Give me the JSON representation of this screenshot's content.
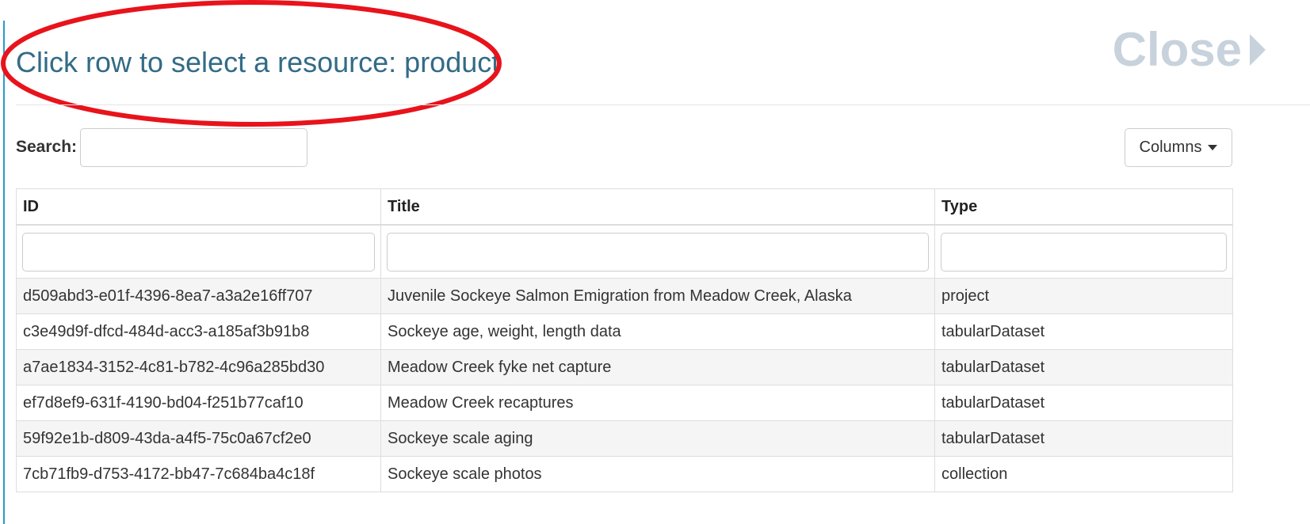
{
  "modal": {
    "title": "Click row to select a resource: product",
    "close_label": "Close"
  },
  "search": {
    "label": "Search:",
    "value": "",
    "placeholder": ""
  },
  "columns_button": {
    "label": "Columns"
  },
  "annotation": {
    "color": "#e8131b"
  },
  "table": {
    "headers": [
      "ID",
      "Title",
      "Type"
    ],
    "filters": [
      "",
      "",
      ""
    ],
    "rows": [
      {
        "id": "d509abd3-e01f-4396-8ea7-a3a2e16ff707",
        "title": "Juvenile Sockeye Salmon Emigration from Meadow Creek, Alaska",
        "type": "project"
      },
      {
        "id": "c3e49d9f-dfcd-484d-acc3-a185af3b91b8",
        "title": "Sockeye age, weight, length data",
        "type": "tabularDataset"
      },
      {
        "id": "a7ae1834-3152-4c81-b782-4c96a285bd30",
        "title": "Meadow Creek fyke net capture",
        "type": "tabularDataset"
      },
      {
        "id": "ef7d8ef9-631f-4190-bd04-f251b77caf10",
        "title": "Meadow Creek recaptures",
        "type": "tabularDataset"
      },
      {
        "id": "59f92e1b-d809-43da-a4f5-75c0a67cf2e0",
        "title": "Sockeye scale aging",
        "type": "tabularDataset"
      },
      {
        "id": "7cb71fb9-d753-4172-bb47-7c684ba4c18f",
        "title": "Sockeye scale photos",
        "type": "collection"
      }
    ]
  }
}
